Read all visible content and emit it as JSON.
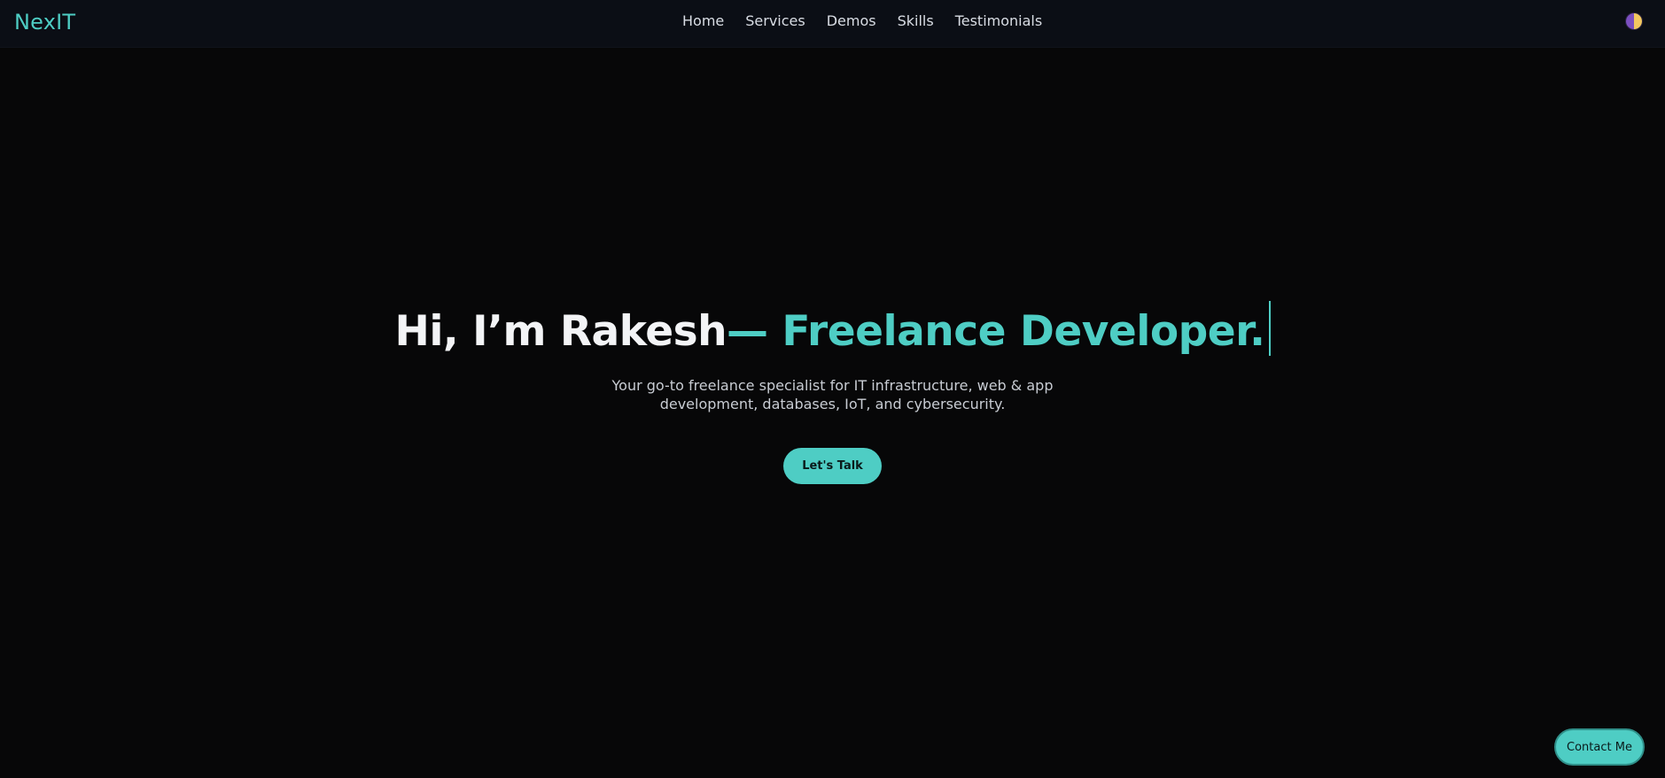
{
  "brand": "NexIT",
  "nav": {
    "items": [
      {
        "label": "Home"
      },
      {
        "label": "Services"
      },
      {
        "label": "Demos"
      },
      {
        "label": "Skills"
      },
      {
        "label": "Testimonials"
      }
    ]
  },
  "theme_toggle": {
    "icon": "theme-toggle-icon"
  },
  "hero": {
    "title_main": "Hi, I’m Rakesh",
    "title_dash": "— ",
    "title_accent": "Freelance Developer.",
    "subtitle": "Your go-to freelance specialist for IT infrastructure, web & app development, databases, IoT, and cybersecurity.",
    "cta_label": "Let's Talk"
  },
  "contact_fab": {
    "label": "Contact Me"
  },
  "colors": {
    "accent": "#4ecdc4",
    "background": "#070708",
    "navbar": "#0b0e15"
  }
}
